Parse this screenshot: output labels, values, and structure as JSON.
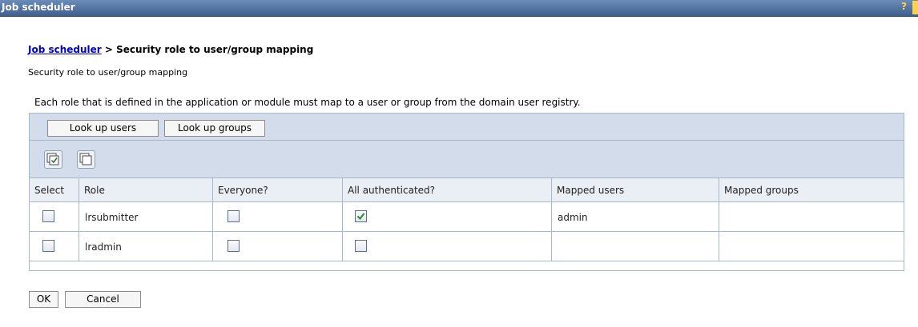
{
  "window": {
    "title": "Job scheduler",
    "help_glyph": "?"
  },
  "breadcrumb": {
    "link": "Job scheduler",
    "separator": " > ",
    "current": "Security role to user/group mapping"
  },
  "subtitle": "Security role to user/group mapping",
  "description": "Each role that is defined in the application or module must map to a user or group from the domain user registry.",
  "toolbar": {
    "lookup_users": "Look up users",
    "lookup_groups": "Look up groups"
  },
  "icons": {
    "select_all": "select-all-icon",
    "deselect_all": "deselect-all-icon"
  },
  "table": {
    "headers": [
      "Select",
      "Role",
      "Everyone?",
      "All authenticated?",
      "Mapped users",
      "Mapped groups"
    ],
    "rows": [
      {
        "select": false,
        "role": "lrsubmitter",
        "everyone": false,
        "all_authenticated": true,
        "mapped_users": "admin",
        "mapped_groups": ""
      },
      {
        "select": false,
        "role": "lradmin",
        "everyone": false,
        "all_authenticated": false,
        "mapped_users": "",
        "mapped_groups": ""
      }
    ]
  },
  "footer": {
    "ok": "OK",
    "cancel": "Cancel"
  },
  "colors": {
    "titlebar": "#3f5f8f",
    "toolbar_bg": "#d3dcea",
    "border": "#a9b7cc",
    "link": "#0000cc",
    "check": "#2a8a2a"
  }
}
